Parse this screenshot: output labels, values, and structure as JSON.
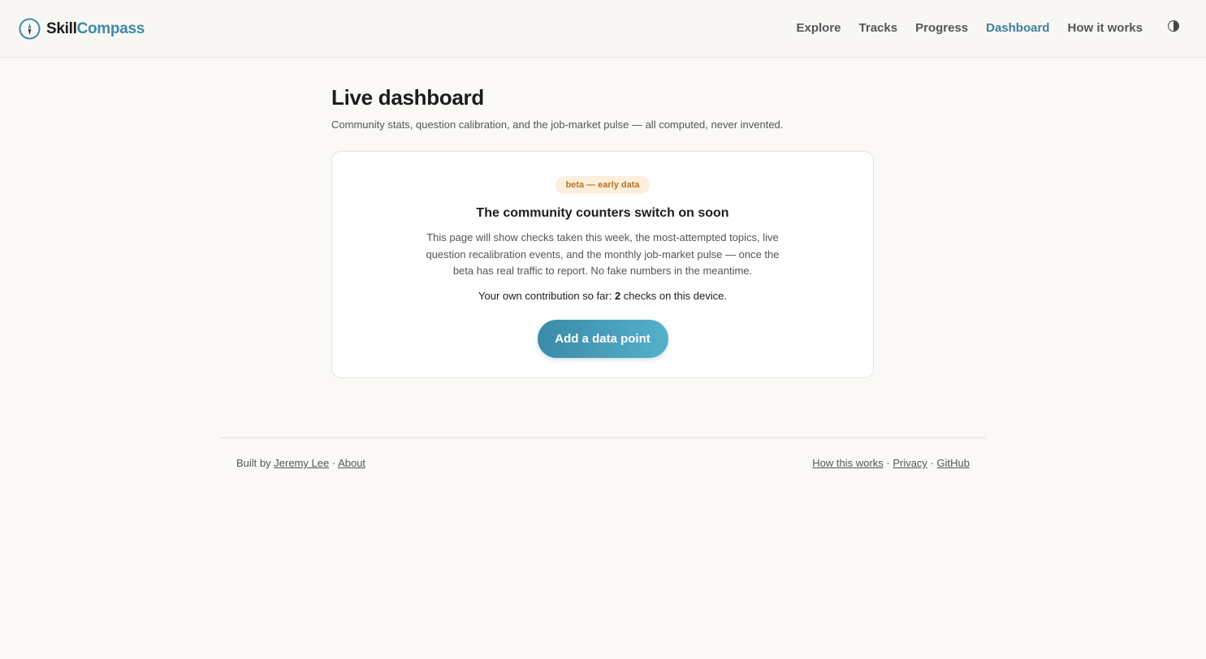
{
  "brand": {
    "name_a": "Skill",
    "name_b": "Compass",
    "icon": "compass-icon"
  },
  "nav": {
    "items": [
      {
        "label": "Explore",
        "active": false
      },
      {
        "label": "Tracks",
        "active": false
      },
      {
        "label": "Progress",
        "active": false
      },
      {
        "label": "Dashboard",
        "active": true
      },
      {
        "label": "How it works",
        "active": false
      }
    ],
    "theme_toggle_icon": "contrast-icon"
  },
  "page": {
    "title": "Live dashboard",
    "subtitle": "Community stats, question calibration, and the job-market pulse — all computed, never invented."
  },
  "card": {
    "badge": "beta — early data",
    "title": "The community counters switch on soon",
    "body": "This page will show checks taken this week, the most-attempted topics, live question recalibration events, and the monthly job-market pulse — once the beta has real traffic to report. No fake numbers in the meantime.",
    "contrib_prefix": "Your own contribution so far: ",
    "contrib_count": "2",
    "contrib_suffix": " checks on this device.",
    "cta_label": "Add a data point"
  },
  "footer": {
    "built_by": "Built by",
    "author": "Jeremy Lee",
    "sep": "·",
    "about": "About",
    "how": "How this works",
    "privacy": "Privacy",
    "github": "GitHub"
  },
  "colors": {
    "accent": "#3f8aa8",
    "badge_bg": "#fcefdb",
    "badge_text": "#b9742a",
    "background": "#faf9f6"
  }
}
